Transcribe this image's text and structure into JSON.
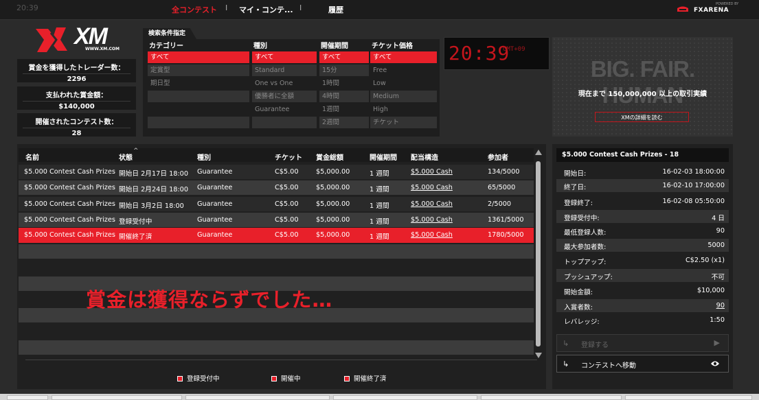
{
  "topbar": {
    "clock": "20:39",
    "nav": [
      "全コンテスト",
      "マイ・コンテ...",
      "履歴"
    ],
    "separator": "I",
    "brand": "FXARENA",
    "brand_powered": "POWERED BY"
  },
  "logo": {
    "text": "XM",
    "url_text": "WWW.XM.COM"
  },
  "stats": [
    {
      "label": "賞金を獲得したトレーダー数：",
      "value": "2296"
    },
    {
      "label": "支払われた賞金額：",
      "value": "$140,000"
    },
    {
      "label": "開催されたコンテスト数：",
      "value": "28"
    }
  ],
  "filters": {
    "tab_label": "検索条件指定",
    "columns": [
      {
        "header": "カテゴリー",
        "options": [
          "すべて",
          "定賞型",
          "期日型",
          "",
          ""
        ]
      },
      {
        "header": "種別",
        "options": [
          "すべて",
          "Standard",
          "One vs One",
          "優勝者に全額",
          "Guarantee",
          ""
        ]
      },
      {
        "header": "開催期間",
        "options": [
          "すべて",
          "15分",
          "1時間",
          "4時間",
          "1週間",
          "2週間"
        ]
      },
      {
        "header": "チケット価格",
        "options": [
          "すべて",
          "Free",
          "Low",
          "Medium",
          "High",
          "チケット"
        ]
      }
    ]
  },
  "led_clock": {
    "time": "20:39",
    "zone": "GMT+09"
  },
  "banner": {
    "title": "BIG. FAIR. HUMAN",
    "subtitle": "現在まで 150,000,000 以上の取引実績",
    "button": "XMの詳細を読む"
  },
  "table": {
    "headers": [
      "名前",
      "状態",
      "種別",
      "チケット",
      "賞金総額",
      "開催期間",
      "配当構造",
      "参加者"
    ],
    "sort_indicator": "^",
    "rows": [
      [
        "$5.000 Contest Cash Prizes",
        "開始日 2月17日 18:00",
        "Guarantee",
        "C$5.00",
        "$5,000.00",
        "1 週間",
        "$5.000 Cash",
        "134/5000"
      ],
      [
        "$5.000 Contest Cash Prizes",
        "開始日 2月24日 18:00",
        "Guarantee",
        "C$5.00",
        "$5,000.00",
        "1 週間",
        "$5.000 Cash",
        "65/5000"
      ],
      [
        "$5.000 Contest Cash Prizes",
        "開始日 3月2日 18:00",
        "Guarantee",
        "C$5.00",
        "$5,000.00",
        "1 週間",
        "$5.000 Cash",
        "2/5000"
      ],
      [
        "$5.000 Contest Cash Prizes",
        "登録受付中",
        "Guarantee",
        "C$5.00",
        "$5,000.00",
        "1 週間",
        "$5.000 Cash",
        "1361/5000"
      ],
      [
        "$5.000 Contest Cash Prizes",
        "開催終了済",
        "Guarantee",
        "C$5.00",
        "$5,000.00",
        "1 週間",
        "$5.000 Cash",
        "1780/5000"
      ]
    ],
    "legend": [
      "登録受付中",
      "開催中",
      "開催終了済"
    ]
  },
  "annotation": "賞金は獲得ならずでした…",
  "details": {
    "title": "$5.000 Contest Cash Prizes - 18",
    "rows": [
      {
        "key": "開始日:",
        "value": "16-02-03 18:00:00"
      },
      {
        "key": "終了日:",
        "value": "16-02-10 17:00:00"
      },
      {
        "key": "登録終了:",
        "value": "16-02-08 05:50:00"
      },
      {
        "key": "登録受付中:",
        "value": "4 日"
      },
      {
        "key": "最低登録人数:",
        "value": "90"
      },
      {
        "key": "最大参加者数:",
        "value": "5000"
      },
      {
        "key": "トップアップ:",
        "value": "C$2.50 (x1)"
      },
      {
        "key": "プッシュアップ:",
        "value": "不可"
      },
      {
        "key": "開始金額:",
        "value": "$10,000"
      },
      {
        "key": "入賞者数:",
        "value": "90"
      },
      {
        "key": "レバレッジ:",
        "value": "1:50"
      }
    ],
    "register_button": "登録する",
    "goto_button": "コンテストへ移動"
  },
  "colors": {
    "accent": "#e8202a",
    "background": "#2b2b2b",
    "panel": "#202020"
  }
}
